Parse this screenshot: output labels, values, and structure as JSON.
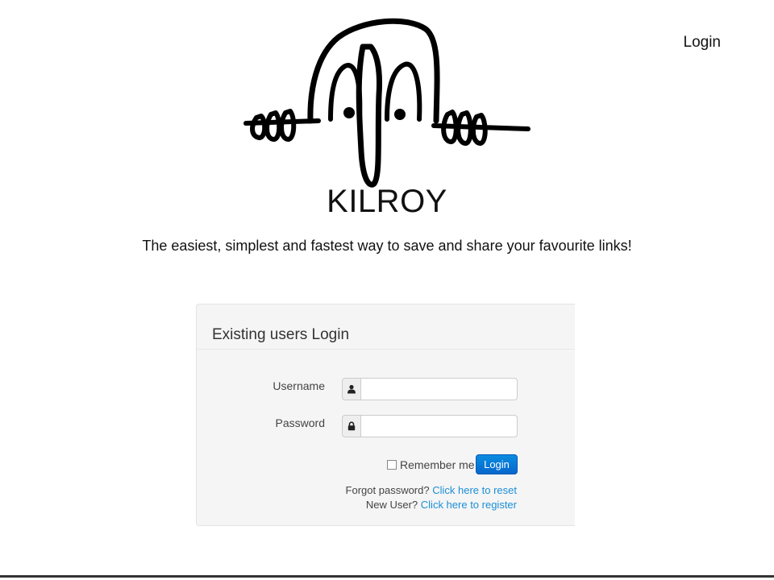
{
  "nav": {
    "login_label": "Login"
  },
  "brand": {
    "name": "KILROY",
    "tagline": "The easiest, simplest and fastest way to save and share your favourite links!"
  },
  "login_panel": {
    "title": "Existing users Login",
    "username_label": "Username",
    "username_value": "",
    "password_label": "Password",
    "password_value": "",
    "remember_label": "Remember me",
    "remember_checked": false,
    "submit_label": "Login",
    "forgot_prefix": "Forgot password?",
    "forgot_link": "Click here to reset",
    "new_user_prefix": "New User?",
    "register_link": "Click here to register"
  },
  "icons": {
    "logo": "kilroy-logo-icon",
    "username": "user-icon",
    "password": "lock-icon"
  },
  "colors": {
    "accent": "#0566cc",
    "link": "#1b8fd6",
    "panel_bg": "#f5f5f5"
  }
}
